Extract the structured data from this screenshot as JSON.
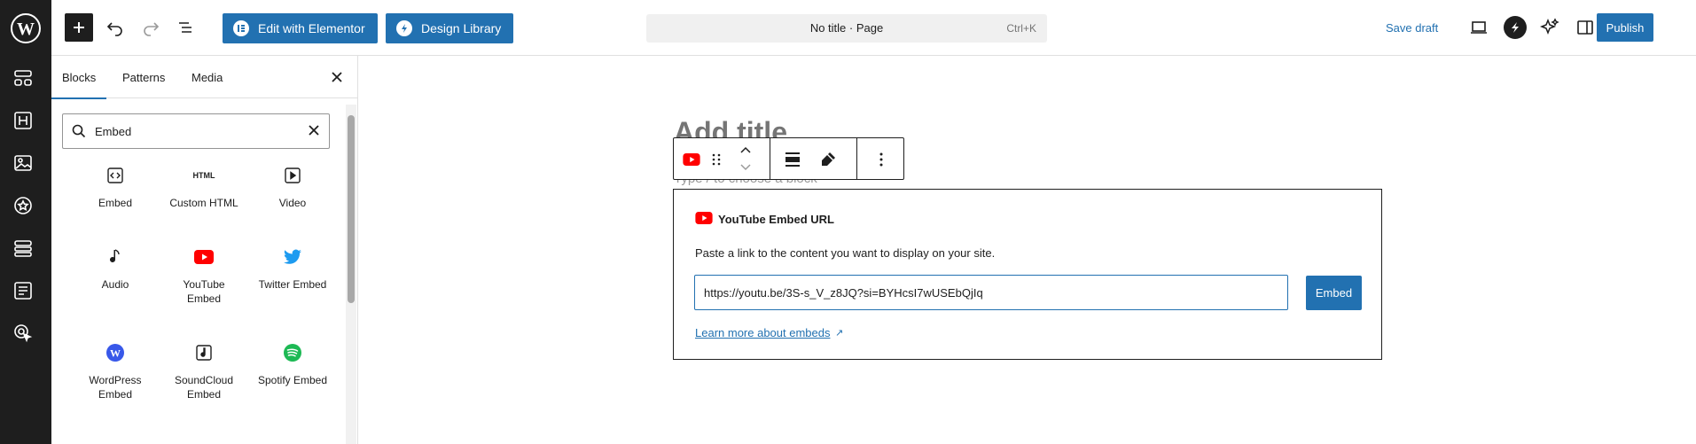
{
  "topbar": {
    "edit_elementor_label": "Edit with Elementor",
    "design_library_label": "Design Library",
    "command_title": "No title · Page",
    "command_shortcut": "Ctrl+K",
    "save_draft_label": "Save draft",
    "publish_label": "Publish"
  },
  "rail": {
    "icons": [
      "wordpress-logo",
      "templates-icon",
      "heading-icon",
      "media-icon",
      "badge-icon",
      "layout-icon",
      "form-icon",
      "cursor-icon"
    ]
  },
  "inserter": {
    "tabs": [
      "Blocks",
      "Patterns",
      "Media"
    ],
    "active_tab": "Blocks",
    "search_value": "Embed",
    "blocks": [
      {
        "line1": "Embed",
        "line2": "",
        "icon": "embed-icon"
      },
      {
        "line1": "Custom HTML",
        "line2": "",
        "icon": "html-icon",
        "icon_text": "HTML"
      },
      {
        "line1": "Video",
        "line2": "",
        "icon": "video-icon"
      },
      {
        "line1": "Audio",
        "line2": "",
        "icon": "audio-icon"
      },
      {
        "line1": "YouTube",
        "line2": "Embed",
        "icon": "youtube-icon"
      },
      {
        "line1": "Twitter Embed",
        "line2": "",
        "icon": "twitter-icon"
      },
      {
        "line1": "WordPress",
        "line2": "Embed",
        "icon": "wordpress-icon"
      },
      {
        "line1": "SoundCloud",
        "line2": "Embed",
        "icon": "soundcloud-icon"
      },
      {
        "line1": "Spotify Embed",
        "line2": "",
        "icon": "spotify-icon"
      }
    ]
  },
  "editor": {
    "title_placeholder": "Add title",
    "block_hint": "Type / to choose a block",
    "embed": {
      "heading": "YouTube Embed URL",
      "description": "Paste a link to the content you want to display on your site.",
      "url_value": "https://youtu.be/3S-s_V_z8JQ?si=BYHcsI7wUSEbQjIq",
      "embed_button": "Embed",
      "learn_more": "Learn more about embeds",
      "learn_more_arrow": "↗"
    }
  },
  "colors": {
    "accent": "#2271b1",
    "youtube_red": "#ff0000",
    "twitter_blue": "#1d9bf0",
    "spotify_green": "#1db954",
    "rail_dark": "#1e1e1e"
  }
}
